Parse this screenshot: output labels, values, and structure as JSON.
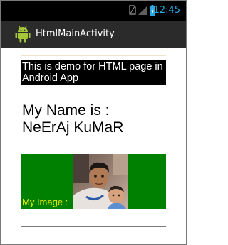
{
  "status_bar": {
    "time": "12:45",
    "icons": [
      "no-sim-icon",
      "signal-icon",
      "battery-icon"
    ],
    "time_color": "#2aa9e0"
  },
  "action_bar": {
    "title": "HtmlMainActivity",
    "icon": "android-app-icon"
  },
  "content": {
    "intro_text": "This is demo for HTML page in Android App",
    "heading_line1": "My Name is :",
    "heading_line2": "NeErAj KuMaR",
    "image_label": "My Image :",
    "image_icon": "profile-photo",
    "panel_color": "#008000",
    "label_color": "#e9e900"
  }
}
